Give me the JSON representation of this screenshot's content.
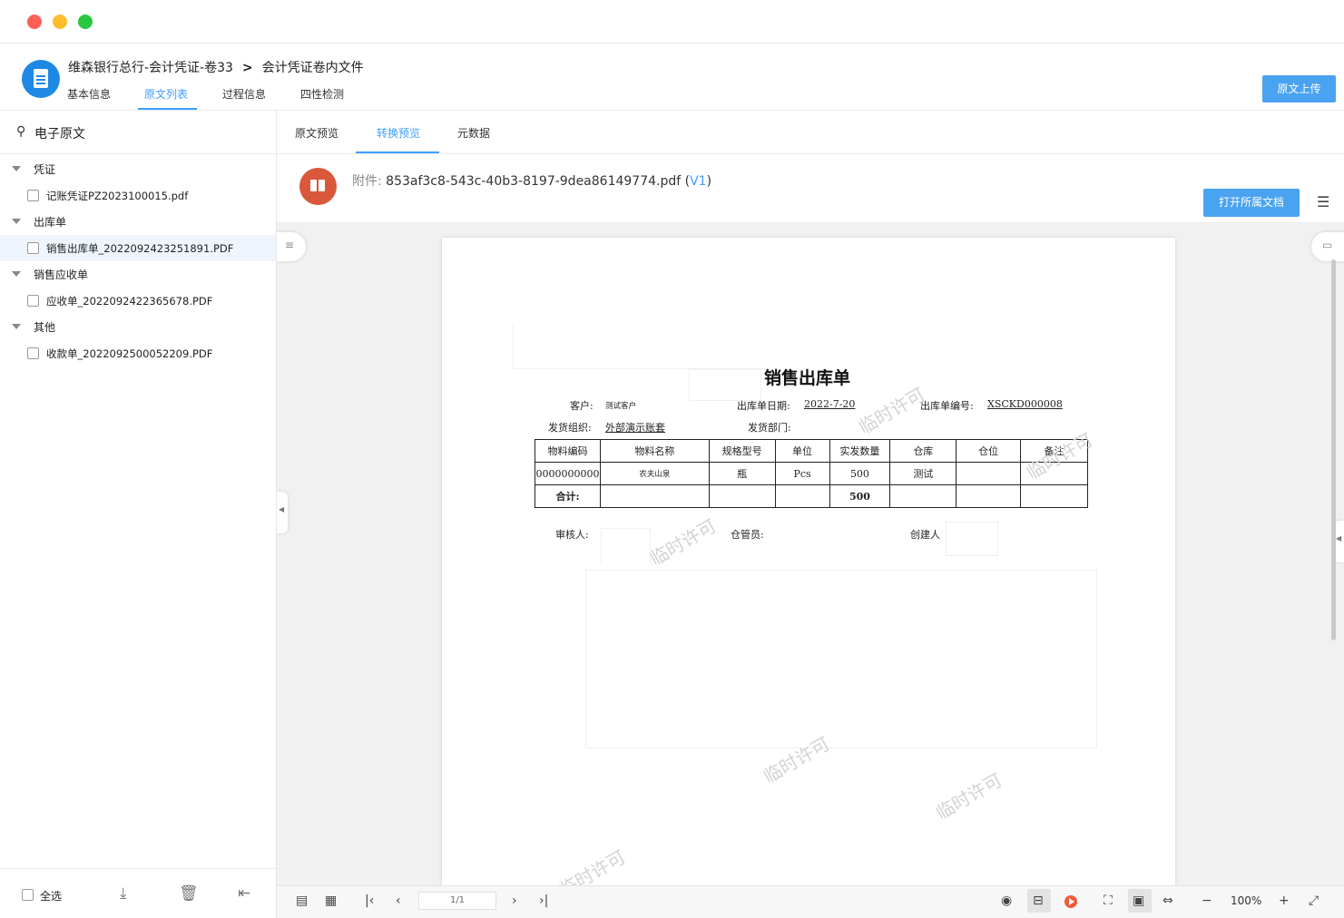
{
  "header": {
    "breadcrumb_1": "维森银行总行-会计凭证-卷33",
    "breadcrumb_sep": ">",
    "breadcrumb_2": "会计凭证卷内文件",
    "tabs": [
      {
        "label": "基本信息"
      },
      {
        "label": "原文列表"
      },
      {
        "label": "过程信息"
      },
      {
        "label": "四性检测"
      }
    ],
    "upload_label": "原文上传"
  },
  "sidebar": {
    "title": "电子原文",
    "groups": [
      {
        "label": "凭证",
        "files": [
          "记账凭证PZ2023100015.pdf"
        ]
      },
      {
        "label": "出库单",
        "files": [
          "销售出库单_2022092423251891.PDF"
        ]
      },
      {
        "label": "销售应收单",
        "files": [
          "应收单_2022092422365678.PDF"
        ]
      },
      {
        "label": "其他",
        "files": [
          "收款单_2022092500052209.PDF"
        ]
      }
    ],
    "select_all": "全选"
  },
  "main": {
    "tabs": [
      {
        "label": "原文预览"
      },
      {
        "label": "转换预览"
      },
      {
        "label": "元数据"
      }
    ],
    "attachment_prefix": "附件:",
    "attachment_name": "853af3c8-543c-40b3-8197-9dea86149774.pdf",
    "attachment_version": "V1",
    "open_doc_label": "打开所属文档"
  },
  "document": {
    "title": "销售出库单",
    "customer_label": "客户:",
    "customer_value": "测试客户",
    "date_label": "出库单日期:",
    "date_value": "2022-7-20",
    "number_label": "出库单编号:",
    "number_value": "XSCKD000008",
    "org_label": "发货组织:",
    "org_value": "外部演示账套",
    "dept_label": "发货部门:",
    "table_headers": [
      "物料编码",
      "物料名称",
      "规格型号",
      "单位",
      "实发数量",
      "仓库",
      "仓位",
      "备注"
    ],
    "table_row": [
      "0000000000",
      "农夫山泉",
      "瓶",
      "Pcs",
      "500",
      "测试",
      "",
      ""
    ],
    "total_label": "合计:",
    "total_qty": "500",
    "reviewer_label": "审核人:",
    "keeper_label": "仓管员:",
    "creator_label": "创建人",
    "watermark": "临时许可"
  },
  "toolbar": {
    "page_indicator": "1/1",
    "zoom": "100%"
  }
}
